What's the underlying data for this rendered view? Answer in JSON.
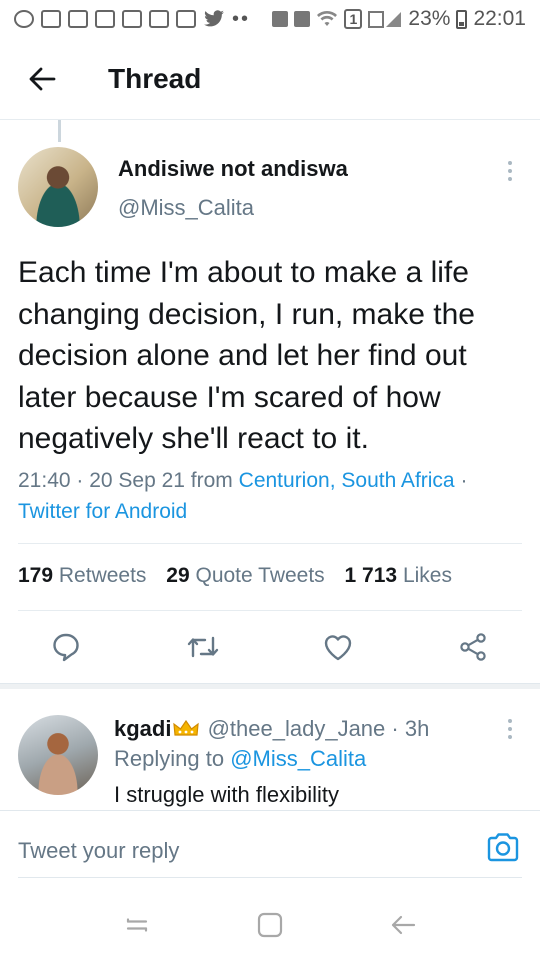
{
  "status_bar": {
    "battery": "23%",
    "time": "22:01",
    "sim_badge": "1"
  },
  "header": {
    "title": "Thread"
  },
  "tweet": {
    "display_name": "Andisiwe not andiswa",
    "handle": "@Miss_Calita",
    "text": "Each time I'm about to make a life changing decision, I run, make the decision alone and let her find out later because I'm scared of how negatively she'll react to it.",
    "time_date": "21:40 · 20 Sep 21 from",
    "location": "Centurion, South Africa",
    "meta_separator": "·",
    "source": "Twitter for Android",
    "retweets_count": "179",
    "retweets_label": "Retweets",
    "quote_count": "29",
    "quote_label": "Quote Tweets",
    "likes_count": "1 713",
    "likes_label": "Likes"
  },
  "reply": {
    "name": "kgadi",
    "handle_time": "@thee_lady_Jane · 3h",
    "replying_prefix": "Replying to",
    "replying_to": "@Miss_Calita",
    "text": "I struggle with flexibility"
  },
  "compose": {
    "placeholder": "Tweet your reply"
  },
  "icons": {
    "back": "arrow-left-icon",
    "more": "more-vertical-icon",
    "reply": "comment-icon",
    "retweet": "retweet-icon",
    "like": "heart-icon",
    "share": "share-icon",
    "camera": "camera-icon",
    "crown": "crown-emoji-icon"
  },
  "colors": {
    "accent": "#1b95e0",
    "secondary_text": "#657786",
    "primary_text": "#14171a"
  }
}
